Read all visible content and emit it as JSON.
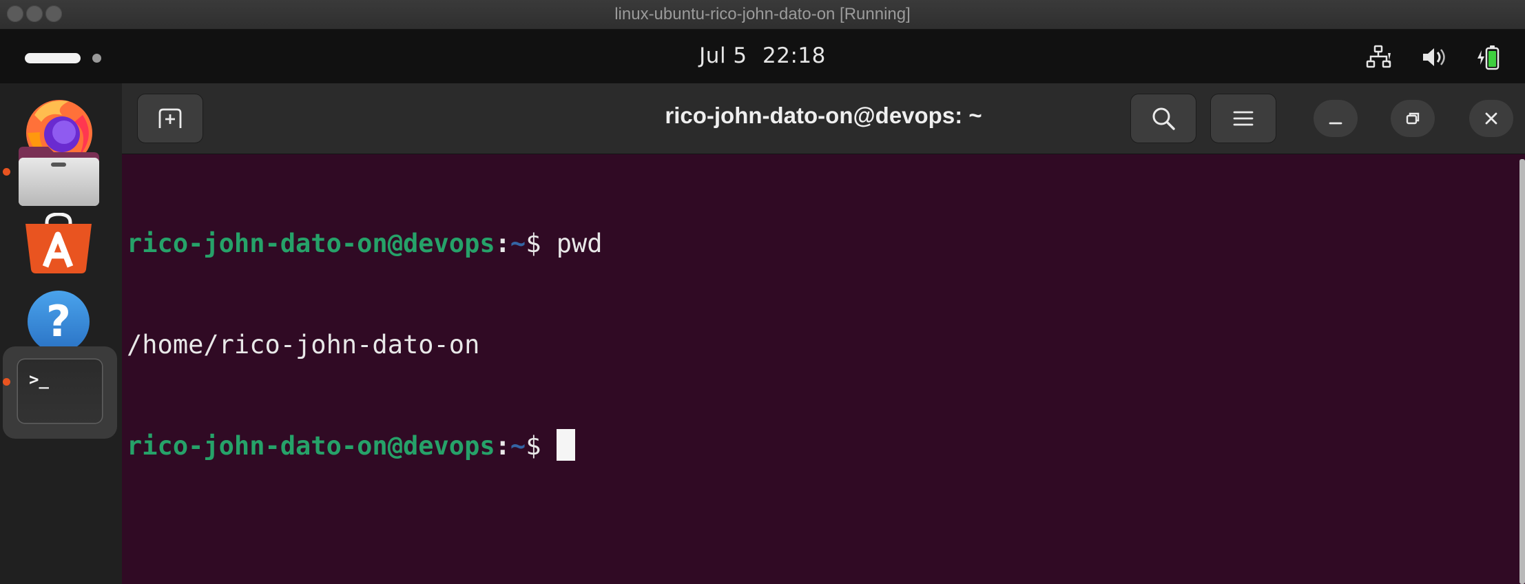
{
  "host_window": {
    "title": "linux-ubuntu-rico-john-dato-on [Running]"
  },
  "top_panel": {
    "date": "Jul 5",
    "time": "22:18",
    "tray_icons": [
      "network-icon",
      "volume-icon",
      "battery-icon"
    ]
  },
  "dock": {
    "items": [
      {
        "name": "firefox",
        "icon": "firefox-icon",
        "running": false
      },
      {
        "name": "files",
        "icon": "files-icon",
        "running": true
      },
      {
        "name": "ubuntu-software",
        "icon": "software-store-icon",
        "running": false
      },
      {
        "name": "help",
        "icon": "help-icon",
        "running": false
      },
      {
        "name": "terminal",
        "icon": "terminal-icon",
        "running": true,
        "active": true
      }
    ],
    "help_glyph": "?",
    "terminal_glyph": ">_"
  },
  "terminal": {
    "title": "rico-john-dato-on@devops: ~",
    "lines": [
      {
        "user_host": "rico-john-dato-on@devops",
        "colon": ":",
        "path": "~",
        "symbol": "$",
        "command": " pwd"
      },
      {
        "output": "/home/rico-john-dato-on"
      },
      {
        "user_host": "rico-john-dato-on@devops",
        "colon": ":",
        "path": "~",
        "symbol": "$",
        "command": " "
      }
    ]
  },
  "colors": {
    "terminal_bg": "#300a24",
    "prompt_user": "#26a269",
    "prompt_path": "#3465a4",
    "accent": "#e95420"
  }
}
